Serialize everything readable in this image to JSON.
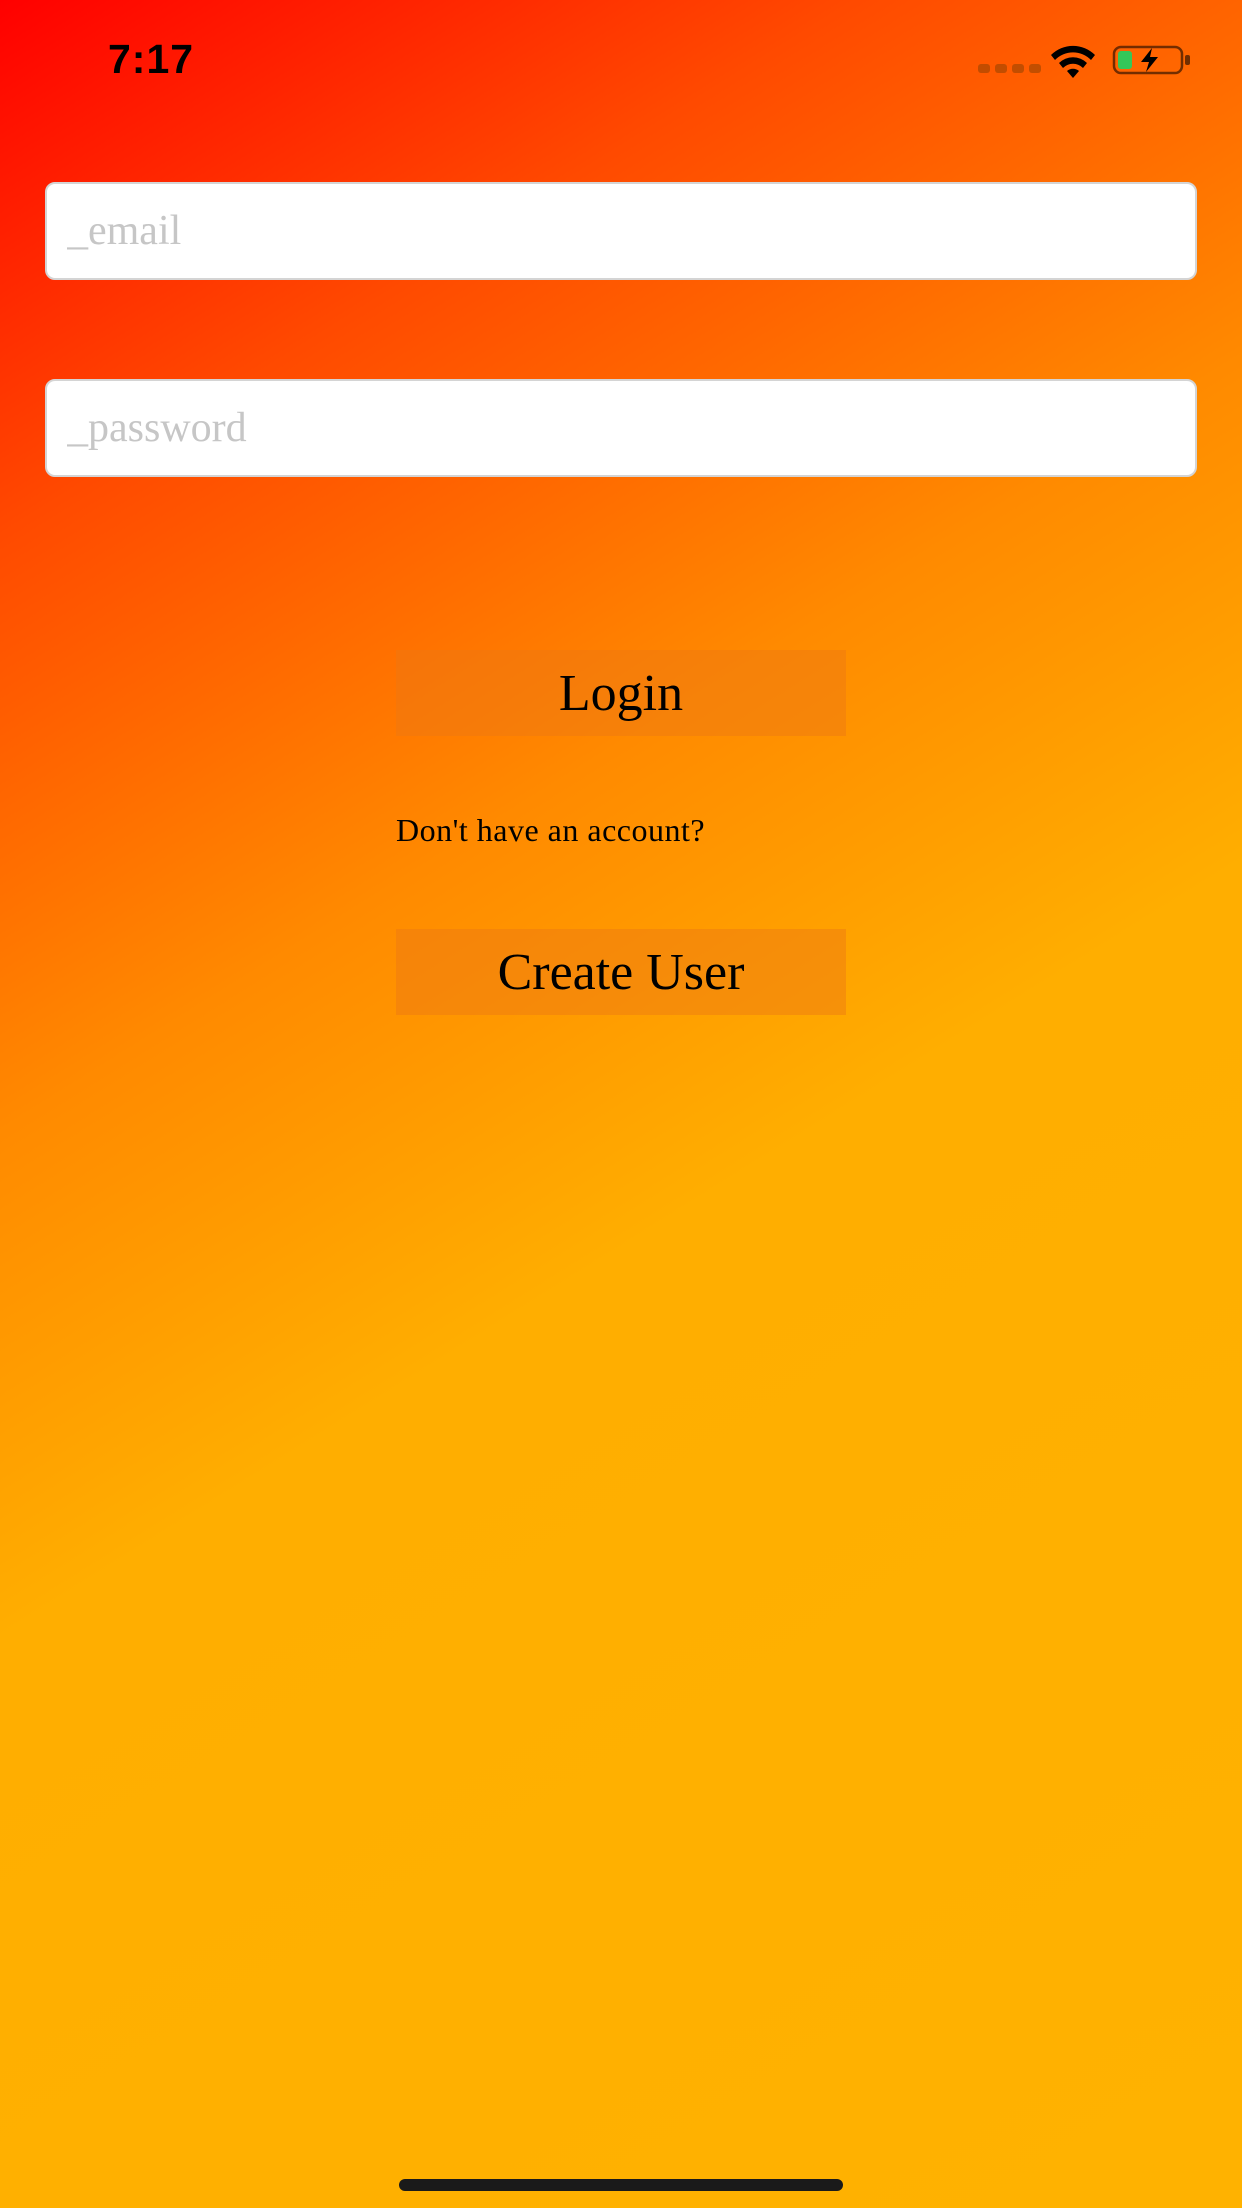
{
  "status_bar": {
    "time": "7:17",
    "signal_icon": "cellular-signal-icon",
    "wifi_icon": "wifi-icon",
    "battery_icon": "battery-charging-icon"
  },
  "form": {
    "email_placeholder": "_email",
    "email_value": "",
    "password_placeholder": "_password",
    "password_value": "",
    "login_label": "Login",
    "account_prompt": "Don't have an account?",
    "create_user_label": "Create User"
  },
  "colors": {
    "gradient_start": "#ff0000",
    "gradient_mid": "#ff8a00",
    "gradient_end": "#ffb200",
    "button_fill": "#f08a14",
    "battery_fill": "#34c759"
  }
}
